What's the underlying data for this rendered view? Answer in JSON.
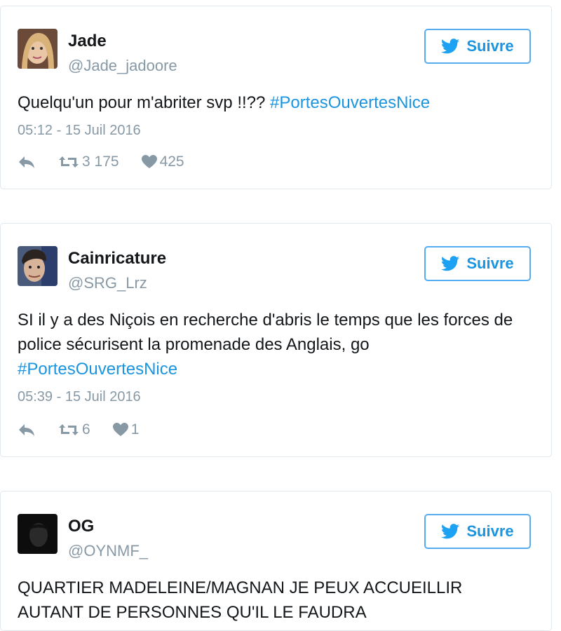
{
  "colors": {
    "link": "#1b95e0",
    "muted": "#8899a6",
    "border": "#e1e8ed",
    "button_border": "#55acee"
  },
  "tweets": [
    {
      "name": "Jade",
      "handle": "@Jade_jadoore",
      "follow_label": "Suivre",
      "text": "Quelqu'un pour m'abriter svp !!?? ",
      "hashtag": "#PortesOuvertesNice",
      "time": "05:12 - 15 Juil 2016",
      "retweets": "3 175",
      "likes": "425"
    },
    {
      "name": "Cainricature",
      "handle": "@SRG_Lrz",
      "follow_label": "Suivre",
      "text": "SI il y a des Niçois en recherche d'abris le temps que les forces de police sécurisent la promenade des Anglais, go ",
      "hashtag": "#PortesOuvertesNice",
      "time": "05:39 - 15 Juil 2016",
      "retweets": "6",
      "likes": "1"
    },
    {
      "name": "OG",
      "handle": "@OYNMF_",
      "follow_label": "Suivre",
      "text": "QUARTIER MADELEINE/MAGNAN JE PEUX ACCUEILLIR AUTANT DE PERSONNES QU'IL LE FAUDRA"
    }
  ]
}
